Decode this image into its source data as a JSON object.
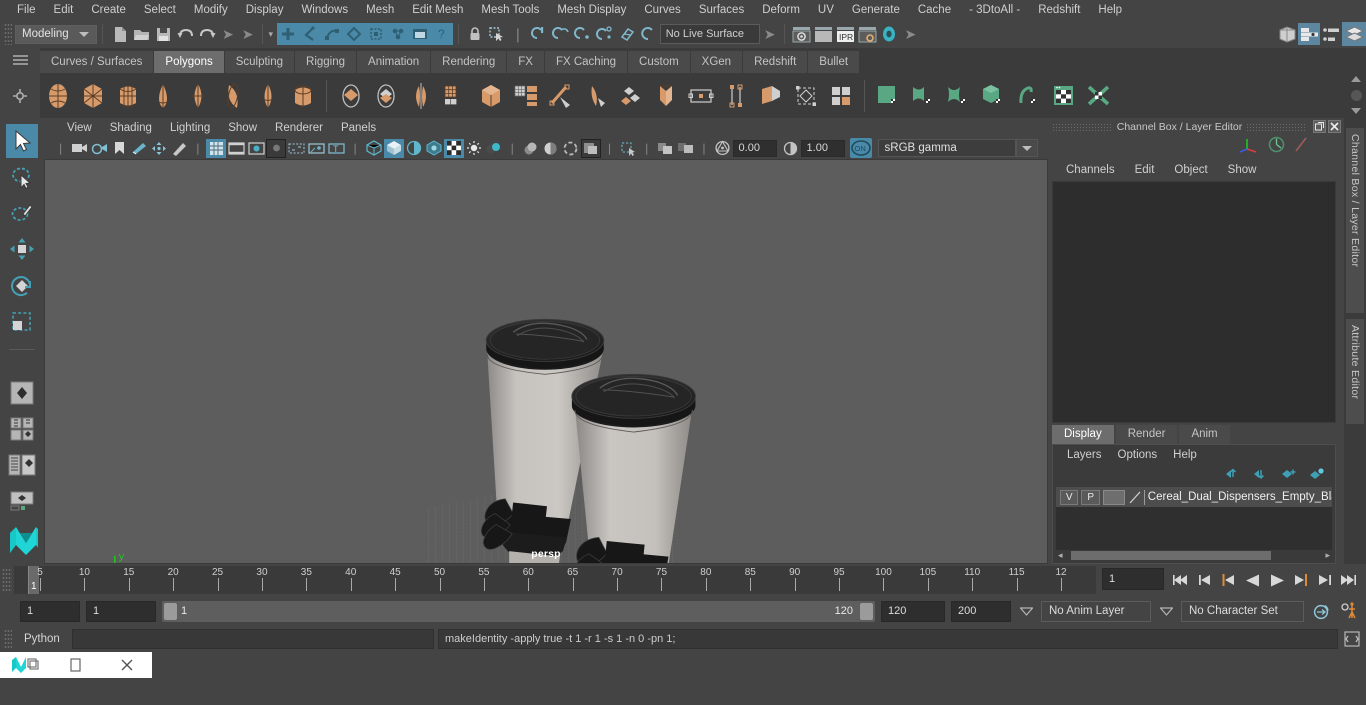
{
  "app": {
    "name": "Autodesk Maya"
  },
  "menubar": [
    "File",
    "Edit",
    "Create",
    "Select",
    "Modify",
    "Display",
    "Windows",
    "Mesh",
    "Edit Mesh",
    "Mesh Tools",
    "Mesh Display",
    "Curves",
    "Surfaces",
    "Deform",
    "UV",
    "Generate",
    "Cache",
    "- 3DtoAll -",
    "Redshift",
    "Help"
  ],
  "status_line": {
    "menu_set": "Modeling",
    "live_surface": "No Live Surface",
    "icons_left": [
      "new-scene-icon",
      "open-scene-icon",
      "save-scene-icon",
      "undo-icon",
      "redo-icon"
    ],
    "select_mode_icons": [
      "select-by-hierarchy-icon",
      "select-by-object-icon",
      "select-by-component-icon",
      "select-mask-icon",
      "select-handle-icon",
      "select-misc-icon",
      "snap-image-plane-icon",
      "help-icon"
    ],
    "lock_icons": [
      "lock-icon",
      "highlight-selection-icon"
    ],
    "snap_icons": [
      "snap-to-grid-icon",
      "snap-to-curve-icon",
      "snap-to-point-icon",
      "snap-to-projected-center-icon",
      "snap-to-view-plane-icon",
      "make-live-icon"
    ],
    "render_icons": [
      "render-current-frame-icon",
      "render-sequence-icon",
      "ipr-render-icon",
      "render-settings-icon",
      "hypershade-icon"
    ],
    "right_icons": [
      "show-hide-modeling-toolkit-icon",
      "show-hide-attribute-editor-icon",
      "show-hide-tool-settings-icon",
      "show-hide-channel-box-icon"
    ]
  },
  "shelf": {
    "tabs": [
      "Curves / Surfaces",
      "Polygons",
      "Sculpting",
      "Rigging",
      "Animation",
      "Rendering",
      "FX",
      "FX Caching",
      "Custom",
      "XGen",
      "Redshift",
      "Bullet"
    ],
    "active_tab": "Polygons",
    "group_a": [
      "poly-sphere-icon",
      "poly-cube-icon",
      "poly-cylinder-icon",
      "poly-cone-icon",
      "poly-torus-icon",
      "poly-plane-icon",
      "poly-disc-icon",
      "poly-platonic-icon"
    ],
    "group_b": [
      "poly-combine-icon",
      "poly-separate-icon",
      "poly-mirror-icon",
      "poly-smooth-icon",
      "poly-boolean-icon",
      "poly-reduce-icon",
      "poly-extract-icon",
      "poly-extrude-icon",
      "poly-bevel-icon",
      "poly-bridge-icon",
      "poly-fill-hole-icon",
      "poly-append-icon",
      "poly-wedge-icon",
      "poly-chamfer-icon",
      "poly-quad-draw-icon"
    ],
    "group_c": [
      "uv-planar-icon",
      "uv-cylindrical-icon",
      "uv-spherical-icon",
      "uv-automatic-icon",
      "uv-unfold-icon",
      "uv-editor-icon",
      "uv-snapshot-icon"
    ]
  },
  "toolbox": {
    "tools": [
      {
        "name": "select-tool-icon",
        "selected": true
      },
      {
        "name": "lasso-select-tool-icon",
        "selected": false
      },
      {
        "name": "paint-select-tool-icon",
        "selected": false
      },
      {
        "name": "move-tool-icon",
        "selected": false
      },
      {
        "name": "rotate-tool-icon",
        "selected": false
      },
      {
        "name": "scale-tool-icon",
        "selected": false
      },
      {
        "name": "last-tool-used-icon",
        "selected": false
      }
    ],
    "layout_buttons": [
      "single-perspective-view-icon",
      "four-view-layout-icon",
      "persp-outliner-layout-icon",
      "persp-graph-editor-layout-icon",
      "maya-logo-icon"
    ]
  },
  "viewport": {
    "menus": [
      "View",
      "Shading",
      "Lighting",
      "Show",
      "Renderer",
      "Panels"
    ],
    "camera_label": "persp",
    "exposure": "0.00",
    "gamma": "1.00",
    "color_space": "sRGB gamma",
    "color_management_toggle": "ON",
    "toolbar_icons": [
      "select-camera-icon",
      "camera-attributes-icon",
      "bookmark-icon",
      "image-plane-icon",
      "2d-pan-zoom-icon",
      "grease-pencil-icon",
      "grid-toggle-icon",
      "film-gate-icon",
      "resolution-gate-icon",
      "gate-mask-icon",
      "film-origin-icon",
      "safe-action-icon",
      "safe-title-icon",
      "wireframe-icon",
      "smooth-shade-all-icon",
      "shaded-wireframe-icon",
      "textured-icon",
      "use-all-lights-icon",
      "shadows-icon",
      "screen-space-ao-icon",
      "motion-blur-icon",
      "multisample-aa-icon",
      "depth-of-field-icon",
      "isolate-select-icon",
      "xray-icon",
      "xray-joints-icon",
      "xray-active-components-icon",
      "exposure-icon",
      "gamma-icon"
    ],
    "background_color": "#5d5d5d",
    "grid_color": "#6e6e6e"
  },
  "channel_box": {
    "title": "Channel Box / Layer Editor",
    "menus": [
      "Channels",
      "Edit",
      "Object",
      "Show"
    ],
    "gizmo_icons": [
      "axis-gizmo-icon",
      "speedometer-icon",
      "slash-icon"
    ],
    "window_buttons": [
      "undock-icon",
      "close-icon"
    ],
    "empty": true
  },
  "layer_editor": {
    "tabs": [
      "Display",
      "Render",
      "Anim"
    ],
    "active_tab": "Display",
    "menus": [
      "Layers",
      "Options",
      "Help"
    ],
    "buttons": [
      "move-layer-up-icon",
      "move-layer-down-icon",
      "create-new-layer-icon",
      "create-layer-from-selected-icon"
    ],
    "layers": [
      {
        "visibility": "V",
        "playback": "P",
        "color_swatch": "#6e6e6e",
        "name": "Cereal_Dual_Dispensers_Empty_Black"
      }
    ]
  },
  "right_vtabs": [
    "Channel Box / Layer Editor",
    "Attribute Editor"
  ],
  "time_slider": {
    "tick_labels": [
      "5",
      "10",
      "15",
      "20",
      "25",
      "30",
      "35",
      "40",
      "45",
      "50",
      "55",
      "60",
      "65",
      "70",
      "75",
      "80",
      "85",
      "90",
      "95",
      "100",
      "105",
      "110",
      "115",
      "12"
    ],
    "current_frame_marker": "1",
    "current_frame_field": "1",
    "playback_buttons": [
      "go-to-start-icon",
      "step-back-keyframe-icon",
      "step-back-frame-icon",
      "play-backwards-icon",
      "play-forwards-icon",
      "step-forward-frame-icon",
      "step-forward-keyframe-icon",
      "go-to-end-icon"
    ]
  },
  "range_slider": {
    "anim_start": "1",
    "playback_start": "1",
    "range_left_label": "1",
    "range_right_label": "120",
    "playback_end": "120",
    "anim_end": "200",
    "anim_layer": "No Anim Layer",
    "character_set": "No Character Set",
    "right_icons": [
      "auto-key-icon",
      "animation-preferences-icon"
    ]
  },
  "command_line": {
    "language_label": "Python",
    "input_value": "",
    "echo": "makeIdentity -apply true -t 1 -r 1 -s 1 -n 0 -pn 1;",
    "script_editor_icon": "script-editor-icon"
  },
  "taskbar": {
    "items": [
      "maya-app-icon",
      "restore-window-icon",
      "close-window-icon"
    ]
  },
  "colors": {
    "accent_blue": "#4a89a8",
    "shelf_orange": "#d79a6a",
    "shelf_green": "#5aa883",
    "panel_bg": "#444444",
    "viewport_bg": "#5d5d5d",
    "field_bg": "#2e2e2e"
  }
}
